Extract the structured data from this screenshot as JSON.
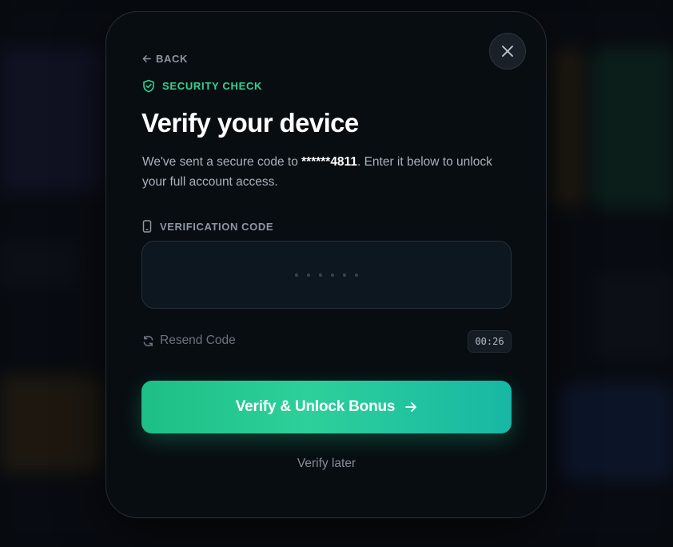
{
  "modal": {
    "back_label": "BACK",
    "badge_label": "SECURITY CHECK",
    "title": "Verify your device",
    "description_prefix": "We've sent a secure code to ",
    "masked_phone": "******4811",
    "description_suffix": ". Enter it below to unlock your full account access.",
    "field_label": "VERIFICATION CODE",
    "code_length": 6,
    "resend_label": "Resend Code",
    "timer": "00:26",
    "primary_button_label": "Verify & Unlock Bonus",
    "secondary_label": "Verify later"
  },
  "icons": {
    "close": "close-icon",
    "back": "arrow-left-icon",
    "badge": "shield-check-icon",
    "field": "phone-icon",
    "resend": "refresh-icon",
    "primary": "arrow-right-icon"
  },
  "colors": {
    "accent": "#2fd593",
    "button_gradient_start": "#1dbf86",
    "button_gradient_end": "#17b7a4",
    "modal_background": "#080d12"
  }
}
